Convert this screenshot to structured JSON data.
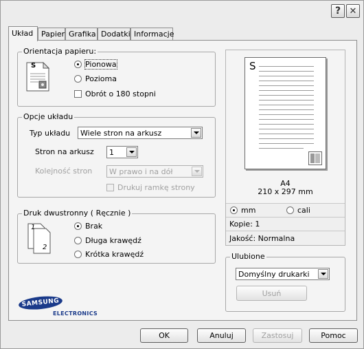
{
  "titlebar": {
    "help_glyph": "?",
    "close_glyph": "✕"
  },
  "tabs": [
    {
      "label": "Układ",
      "active": true
    },
    {
      "label": "Papier"
    },
    {
      "label": "Grafika"
    },
    {
      "label": "Dodatki"
    },
    {
      "label": "Informacje"
    }
  ],
  "orientation": {
    "title": "Orientacja papieru:",
    "icon_letter": "S",
    "portrait": "Pionowa",
    "landscape": "Pozioma",
    "rotate": "Obrót o 180 stopni",
    "selected": "portrait"
  },
  "layout": {
    "title": "Opcje układu",
    "type_label": "Typ układu",
    "type_value": "Wiele stron na arkusz",
    "pages_label": "Stron na arkusz",
    "pages_value": "1",
    "order_label": "Kolejność stron",
    "order_value": "W prawo i na dół",
    "border_label": "Drukuj ramkę strony"
  },
  "duplex": {
    "title": "Druk dwustronny ( Ręcznie )",
    "icon_num1": "1",
    "icon_num2": "2",
    "none": "Brak",
    "long": "Długa krawędź",
    "short": "Krótka krawędź",
    "selected": "none"
  },
  "preview": {
    "page_letter": "S",
    "paper_name": "A4",
    "paper_size": "210 x 297 mm",
    "unit_mm": "mm",
    "unit_inch": "cali",
    "unit_selected": "mm",
    "copies": "Kopie: 1",
    "quality": "Jakość: Normalna"
  },
  "favorites": {
    "title": "Ulubione",
    "value": "Domyślny drukarki",
    "delete_label": "Usuń"
  },
  "logo": {
    "brand": "SAMSUNG",
    "sub": "ELECTRONICS",
    "color": "#1a3a8a"
  },
  "buttons": {
    "ok": "OK",
    "cancel": "Anuluj",
    "apply": "Zastosuj",
    "help": "Pomoc"
  }
}
